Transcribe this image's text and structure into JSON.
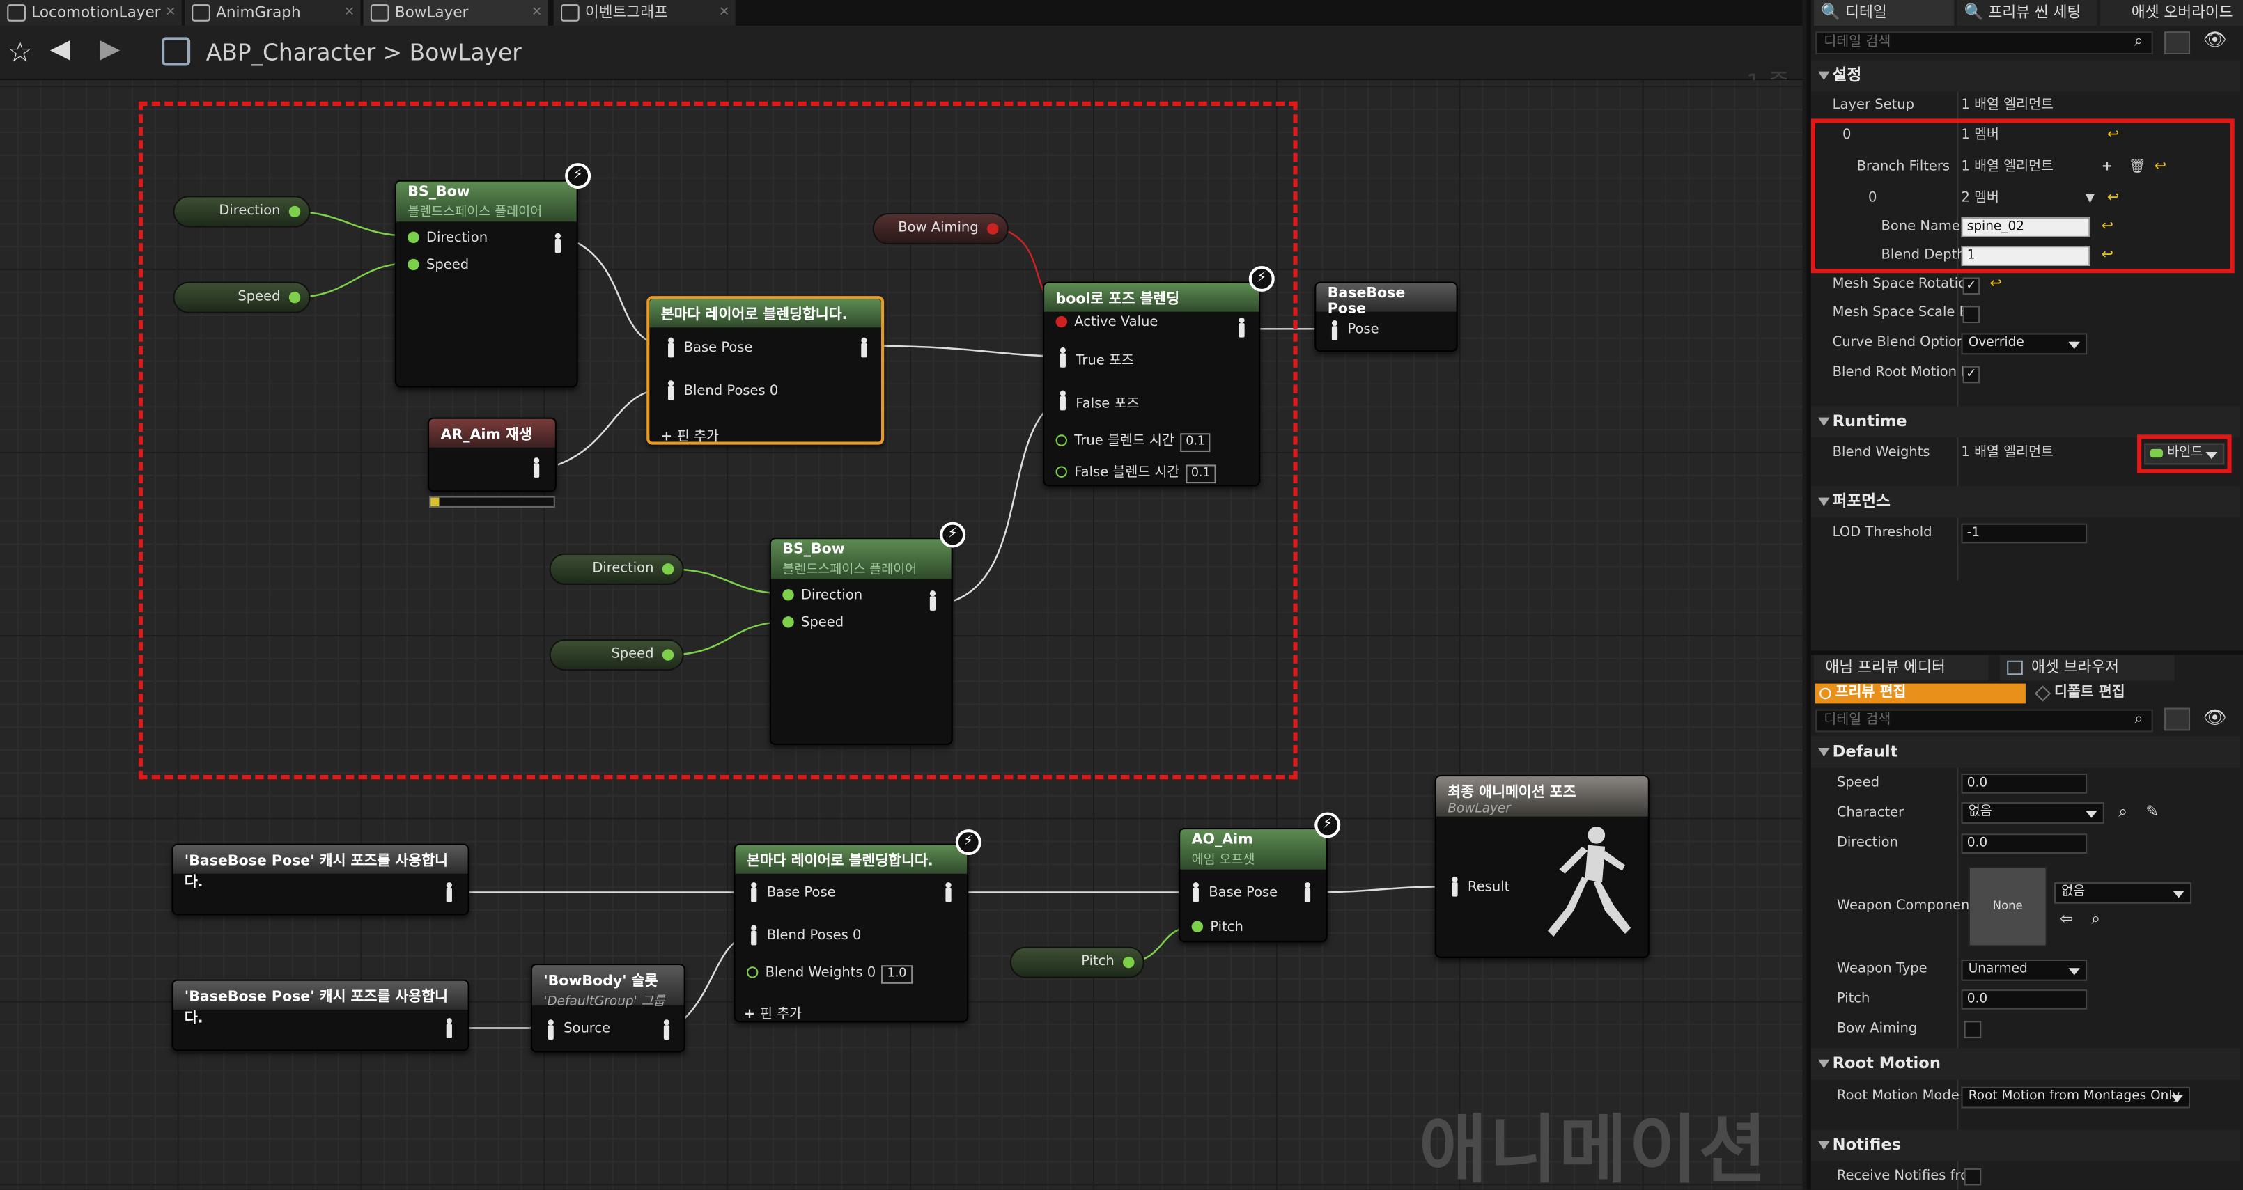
{
  "tabs": [
    {
      "label": "LocomotionLayer"
    },
    {
      "label": "AnimGraph"
    },
    {
      "label": "BowLayer"
    },
    {
      "label": "이벤트그래프"
    }
  ],
  "breadcrumb": {
    "blueprint": "ABP_Character",
    "separator": ">",
    "graph": "BowLayer"
  },
  "zoom_label": "-1 줌",
  "watermark": "애니메이션",
  "nodes": {
    "bs_bow_1": {
      "title": "BS_Bow",
      "subtitle": "블렌드스페이스 플레이어",
      "pins": [
        "Direction",
        "Speed"
      ]
    },
    "bs_bow_2": {
      "title": "BS_Bow",
      "subtitle": "블렌드스페이스 플레이어",
      "pins": [
        "Direction",
        "Speed"
      ]
    },
    "layered_1": {
      "title": "본마다 레이어로 블렌딩합니다.",
      "pins": [
        "Base Pose",
        "Blend Poses 0"
      ],
      "add_pin": "핀 추가"
    },
    "ar_aim": {
      "title": "AR_Aim 재생"
    },
    "bool_blend": {
      "title": "bool로 포즈 블렌딩",
      "pins": [
        "Active Value",
        "True 포즈",
        "False 포즈",
        "True 블렌드 시간",
        "False 블렌드 시간"
      ],
      "true_time": "0.1",
      "false_time": "0.1"
    },
    "basebose_pose": {
      "title": "BaseBose Pose",
      "pin": "Pose"
    },
    "cache_1": {
      "title": "'BaseBose Pose' 캐시 포즈를 사용합니다."
    },
    "cache_2": {
      "title": "'BaseBose Pose' 캐시 포즈를 사용합니다."
    },
    "bowbody": {
      "title": "'BowBody' 슬롯",
      "subtitle": "'DefaultGroup' 그룹",
      "pin": "Source"
    },
    "layered_2": {
      "title": "본마다 레이어로 블렌딩합니다.",
      "pins": [
        "Base Pose",
        "Blend Poses 0",
        "Blend Weights 0"
      ],
      "weight": "1.0",
      "add_pin": "핀 추가"
    },
    "ao_aim": {
      "title": "AO_Aim",
      "subtitle": "에임 오프셋",
      "pins": [
        "Base Pose",
        "Pitch"
      ]
    },
    "final": {
      "title": "최종 애니메이션 포즈",
      "subtitle": "BowLayer",
      "pin": "Result"
    }
  },
  "variables": {
    "direction": "Direction",
    "speed": "Speed",
    "bow_aiming": "Bow Aiming",
    "pitch": "Pitch"
  },
  "panel": {
    "tabs": [
      "디테일",
      "프리뷰 씬 세팅",
      "애셋 오버라이드"
    ],
    "search_placeholder": "디테일 검색",
    "settings": {
      "header": "설정",
      "layer_setup": {
        "label": "Layer Setup",
        "value": "1 배열 엘리먼트"
      },
      "idx0": {
        "label": "0",
        "value": "1 멤버"
      },
      "branch_filters": {
        "label": "Branch Filters",
        "value": "1 배열 엘리먼트"
      },
      "bf0": {
        "label": "0",
        "value": "2 멤버"
      },
      "bone_name": {
        "label": "Bone Name",
        "value": "spine_02"
      },
      "blend_depth": {
        "label": "Blend Depth",
        "value": "1"
      },
      "mesh_rot": {
        "label": "Mesh Space Rotatior"
      },
      "mesh_scale": {
        "label": "Mesh Space Scale Bl"
      },
      "curve_blend": {
        "label": "Curve Blend Option",
        "value": "Override"
      },
      "blend_root": {
        "label": "Blend Root Motion B"
      }
    },
    "runtime": {
      "header": "Runtime",
      "blend_weights": {
        "label": "Blend Weights",
        "value": "1 배열 엘리먼트",
        "bind": "바인드"
      }
    },
    "performance": {
      "header": "퍼포먼스",
      "lod": {
        "label": "LOD Threshold",
        "value": "-1"
      }
    },
    "bottom_tabs": [
      "애님 프리뷰 에디터",
      "애셋 브라우저"
    ],
    "preview_edit": "프리뷰 편집",
    "defaults_edit": "디폴트 편집",
    "default": {
      "header": "Default",
      "speed": {
        "label": "Speed",
        "value": "0.0"
      },
      "character": {
        "label": "Character",
        "value": "없음"
      },
      "direction": {
        "label": "Direction",
        "value": "0.0"
      },
      "weapon_component": {
        "label": "Weapon Component",
        "thumb": "None",
        "value": "없음"
      },
      "weapon_type": {
        "label": "Weapon Type",
        "value": "Unarmed"
      },
      "pitch": {
        "label": "Pitch",
        "value": "0.0"
      },
      "bow_aiming": {
        "label": "Bow Aiming"
      }
    },
    "root_motion": {
      "header": "Root Motion",
      "mode": {
        "label": "Root Motion Mode",
        "value": "Root Motion from Montages Only"
      }
    },
    "notifies": {
      "header": "Notifies",
      "receive": {
        "label": "Receive Notifies fror"
      }
    }
  }
}
